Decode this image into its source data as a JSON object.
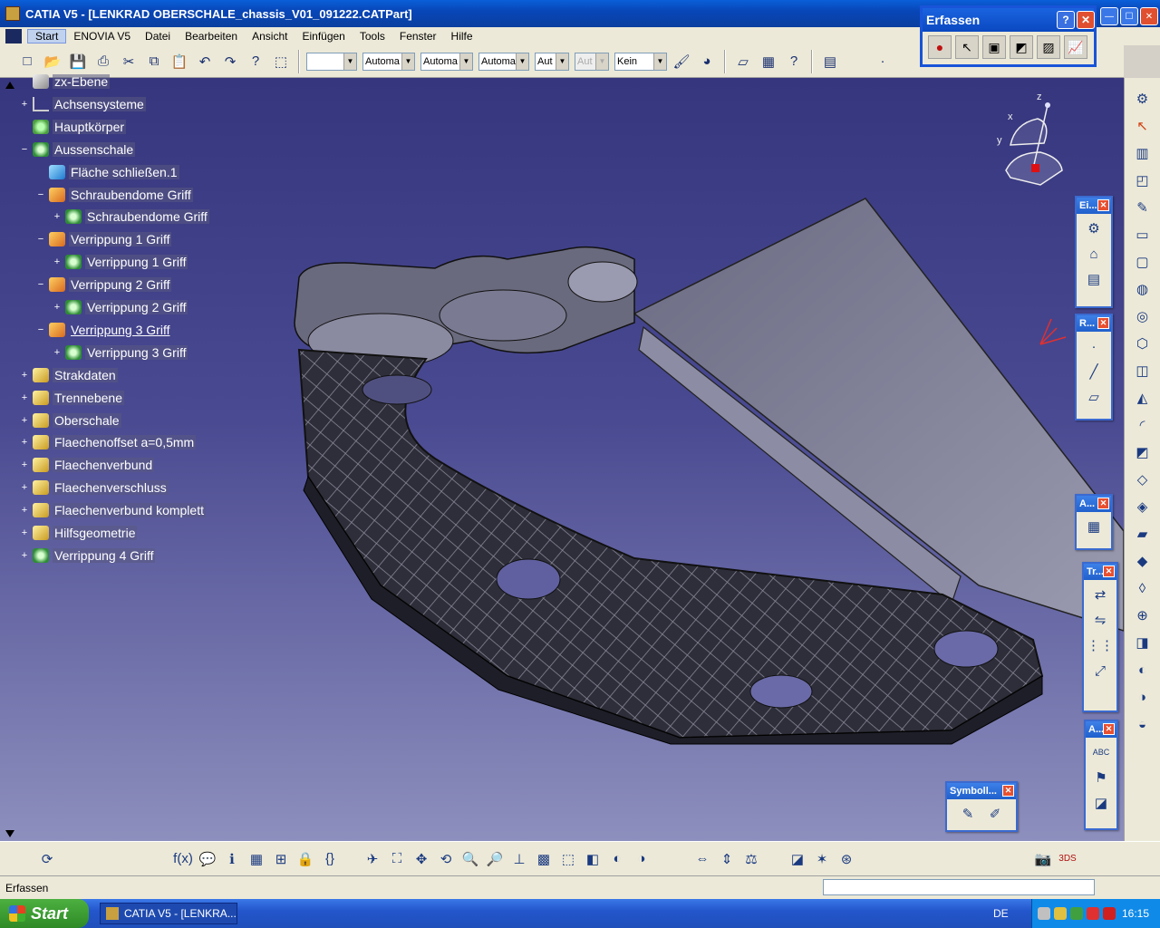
{
  "window": {
    "title": "CATIA V5 - [LENKRAD OBERSCHALE_chassis_V01_091222.CATPart]"
  },
  "menu": [
    "Start",
    "ENOVIA V5",
    "Datei",
    "Bearbeiten",
    "Ansicht",
    "Einfügen",
    "Tools",
    "Fenster",
    "Hilfe"
  ],
  "toolbar": {
    "combos": [
      {
        "value": "",
        "w": 56
      },
      {
        "value": "Automa",
        "w": 58
      },
      {
        "value": "Automa",
        "w": 58
      },
      {
        "value": "Automa",
        "w": 56
      },
      {
        "value": "Aut",
        "w": 38
      },
      {
        "value": "Aut",
        "w": 38
      },
      {
        "value": "Kein",
        "w": 58
      }
    ]
  },
  "tree": [
    {
      "label": "zx-Ebene",
      "icon": "plane",
      "depth": 1,
      "expander": ""
    },
    {
      "label": "Achsensysteme",
      "icon": "axis",
      "depth": 1,
      "expander": "+"
    },
    {
      "label": "Hauptkörper",
      "icon": "gear",
      "depth": 1,
      "expander": ""
    },
    {
      "label": "Aussenschale",
      "icon": "gear-star",
      "depth": 1,
      "expander": "−"
    },
    {
      "label": "Fläche schließen.1",
      "icon": "surface",
      "depth": 2,
      "expander": ""
    },
    {
      "label": "Schraubendome Griff",
      "icon": "ortho",
      "depth": 2,
      "expander": "−"
    },
    {
      "label": "Schraubendome Griff",
      "icon": "gear-star",
      "depth": 3,
      "expander": "+"
    },
    {
      "label": "Verrippung 1 Griff",
      "icon": "ortho",
      "depth": 2,
      "expander": "−"
    },
    {
      "label": "Verrippung 1 Griff",
      "icon": "gear-star",
      "depth": 3,
      "expander": "+"
    },
    {
      "label": "Verrippung 2 Griff",
      "icon": "ortho",
      "depth": 2,
      "expander": "−"
    },
    {
      "label": "Verrippung 2 Griff",
      "icon": "gear-star",
      "depth": 3,
      "expander": "+"
    },
    {
      "label": "Verrippung 3 Griff",
      "icon": "ortho",
      "depth": 2,
      "expander": "−",
      "underline": true
    },
    {
      "label": "Verrippung 3 Griff",
      "icon": "gear-star",
      "depth": 3,
      "expander": "+"
    },
    {
      "label": "Strakdaten",
      "icon": "geoset",
      "depth": 1,
      "expander": "+"
    },
    {
      "label": "Trennebene",
      "icon": "geoset",
      "depth": 1,
      "expander": "+"
    },
    {
      "label": "Oberschale",
      "icon": "geoset",
      "depth": 1,
      "expander": "+"
    },
    {
      "label": "Flaechenoffset a=0,5mm",
      "icon": "geoset",
      "depth": 1,
      "expander": "+"
    },
    {
      "label": "Flaechenverbund",
      "icon": "geoset",
      "depth": 1,
      "expander": "+"
    },
    {
      "label": "Flaechenverschluss",
      "icon": "geoset",
      "depth": 1,
      "expander": "+"
    },
    {
      "label": "Flaechenverbund komplett",
      "icon": "geoset",
      "depth": 1,
      "expander": "+"
    },
    {
      "label": "Hilfsgeometrie",
      "icon": "geoset",
      "depth": 1,
      "expander": "+"
    },
    {
      "label": "Verrippung 4 Griff",
      "icon": "gear-star",
      "depth": 1,
      "expander": "+"
    }
  ],
  "compass": {
    "x": "x",
    "y": "y",
    "z": "z"
  },
  "panels": {
    "erfassen": {
      "title": "Erfassen",
      "help": "?",
      "close": "✕"
    },
    "ei": {
      "title": "Ei..."
    },
    "r": {
      "title": "R..."
    },
    "a1": {
      "title": "A..."
    },
    "tr": {
      "title": "Tr..."
    },
    "a2": {
      "title": "A..."
    },
    "symbol": {
      "title": "Symboll..."
    }
  },
  "status": {
    "text": "Erfassen"
  },
  "taskbar": {
    "start": "Start",
    "task": "CATIA V5 - [LENKRA...",
    "lang": "DE",
    "clock": "16:15"
  }
}
